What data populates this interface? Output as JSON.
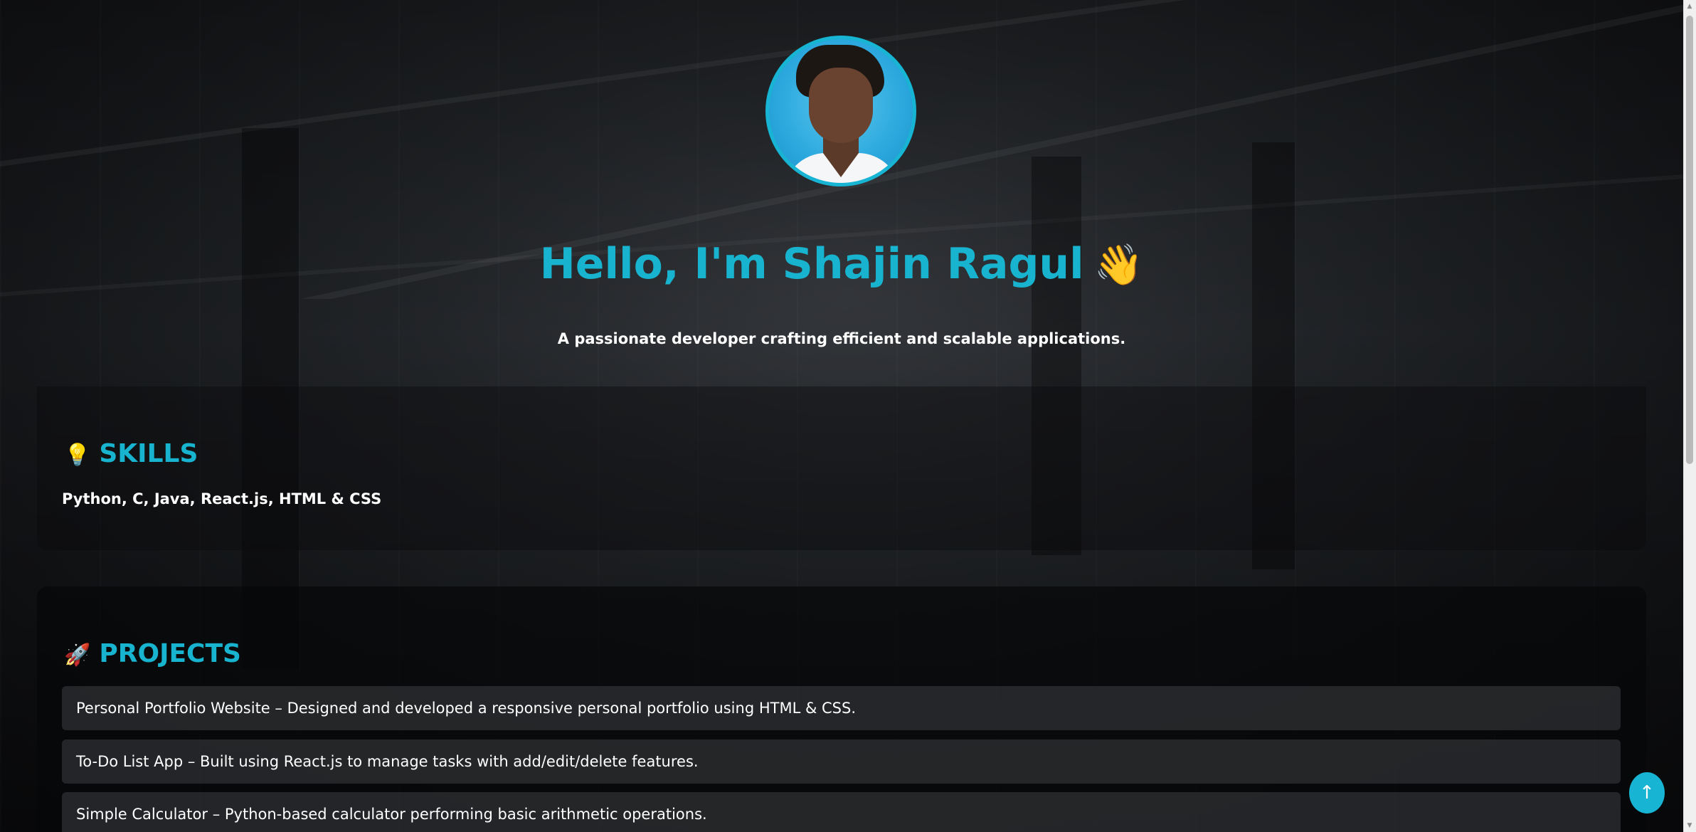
{
  "hero": {
    "greeting": "Hello, I'm Shajin Ragul",
    "wave_emoji": "👋",
    "tagline": "A passionate developer crafting efficient and scalable applications."
  },
  "skills": {
    "icon": "💡",
    "title": "SKILLS",
    "list": "Python, C, Java, React.js, HTML & CSS"
  },
  "projects": {
    "icon": "🚀",
    "title": "PROJECTS",
    "items": [
      "Personal Portfolio Website – Designed and developed a responsive personal portfolio using HTML & CSS.",
      "To-Do List App – Built using React.js to manage tasks with add/edit/delete features.",
      "Simple Calculator – Python-based calculator performing basic arithmetic operations."
    ]
  },
  "back_to_top": {
    "label": "↑"
  },
  "colors": {
    "accent": "#18b4cf",
    "text": "#ffffff"
  }
}
